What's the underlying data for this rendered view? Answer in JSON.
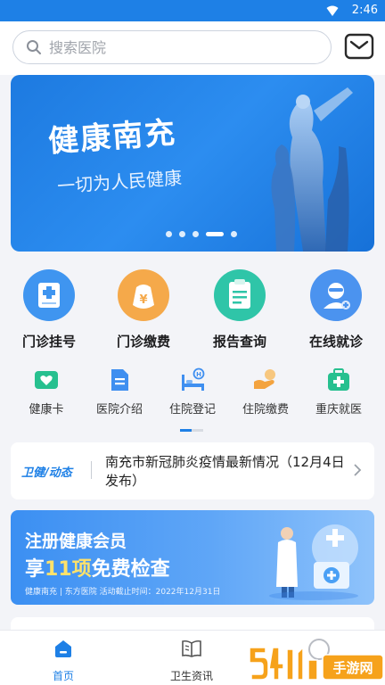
{
  "status_bar": {
    "time": "2:46"
  },
  "search": {
    "placeholder": "搜索医院"
  },
  "banner": {
    "title": "健康南充",
    "subtitle": "一切为人民健康",
    "dot_count": 5,
    "active_dot": 3
  },
  "main_services": [
    {
      "label": "门诊挂号",
      "icon": "registration-icon",
      "color": "#3f95f0"
    },
    {
      "label": "门诊缴费",
      "icon": "payment-icon",
      "color": "#f5a94a"
    },
    {
      "label": "报告查询",
      "icon": "report-icon",
      "color": "#2fc5a8"
    },
    {
      "label": "在线就诊",
      "icon": "doctor-icon",
      "color": "#4b93ef"
    }
  ],
  "sub_services": [
    {
      "label": "健康卡",
      "icon": "health-card-icon",
      "color": "#27c08f"
    },
    {
      "label": "医院介绍",
      "icon": "hospital-info-icon",
      "color": "#3f8ff0"
    },
    {
      "label": "住院登记",
      "icon": "bed-icon",
      "color": "#3f8ff0"
    },
    {
      "label": "住院缴费",
      "icon": "inpatient-payment-icon",
      "color": "#f3a33f"
    },
    {
      "label": "重庆就医",
      "icon": "medical-kit-icon",
      "color": "#27c08f"
    }
  ],
  "news": {
    "tag_left": "卫健",
    "tag_right": "动态",
    "text": "南充市新冠肺炎疫情最新情况（12月4日发布）"
  },
  "promo": {
    "line1": "注册健康会员",
    "line2_prefix": "享",
    "line2_highlight": "11项",
    "line2_suffix": "免费检查",
    "line3": "健康南充 | 东方医院   活动截止时间：2022年12月31日"
  },
  "tabs": [
    {
      "label": "首页",
      "icon": "home-icon",
      "active": true
    },
    {
      "label": "卫生资讯",
      "icon": "book-icon",
      "active": false
    }
  ],
  "watermark": {
    "text": "54119手游网"
  },
  "colors": {
    "accent": "#1e80e6",
    "highlight": "#ffe26a"
  }
}
